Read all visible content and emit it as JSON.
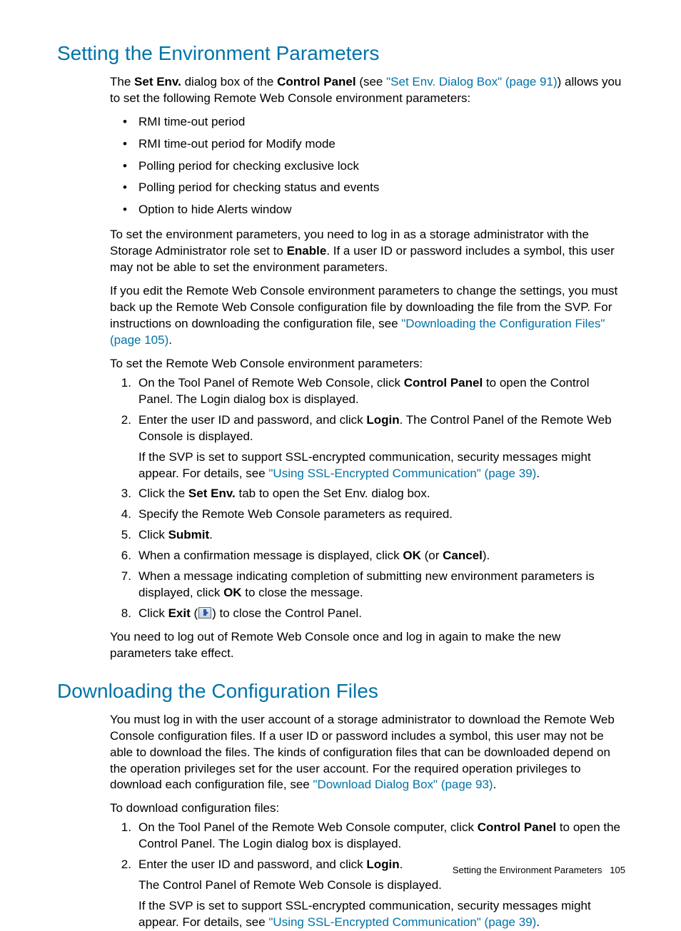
{
  "section1": {
    "heading": "Setting the Environment Parameters",
    "intro_pre": "The ",
    "intro_b1": "Set Env.",
    "intro_mid1": " dialog box of the ",
    "intro_b2": "Control Panel",
    "intro_mid2": " (see ",
    "intro_link": "\"Set Env. Dialog Box\" (page 91)",
    "intro_post": ") allows you to set the following Remote Web Console environment parameters:",
    "bullets": [
      "RMI time-out period",
      "RMI time-out period for Modify mode",
      "Polling period for checking exclusive lock",
      "Polling period for checking status and events",
      "Option to hide Alerts window"
    ],
    "para2_pre": "To set the environment parameters, you need to log in as a storage administrator with the Storage Administrator role set to ",
    "para2_b": "Enable",
    "para2_post": ". If a user ID or password includes a symbol, this user may not be able to set the environment parameters.",
    "para3_pre": "If you edit the Remote Web Console environment parameters to change the settings, you must back up the Remote Web Console configuration file by downloading the file from the SVP. For instructions on downloading the configuration file, see ",
    "para3_link": "\"Downloading the Configuration Files\" (page 105)",
    "para3_post": ".",
    "para4": "To set the Remote Web Console environment parameters:",
    "steps": {
      "s1_pre": "On the Tool Panel of Remote Web Console, click ",
      "s1_b": "Control Panel",
      "s1_post": " to open the Control Panel. The Login dialog box is displayed.",
      "s2_pre": "Enter the user ID and password, and click ",
      "s2_b": "Login",
      "s2_post": ". The Control Panel of the Remote Web Console is displayed.",
      "s2_sub_pre": "If the SVP is set to support SSL-encrypted communication, security messages might appear. For details, see ",
      "s2_sub_link": "\"Using SSL-Encrypted Communication\" (page 39)",
      "s2_sub_post": ".",
      "s3_pre": "Click the ",
      "s3_b": "Set Env.",
      "s3_post": " tab to open the Set Env. dialog box.",
      "s4": "Specify the Remote Web Console parameters as required.",
      "s5_pre": "Click ",
      "s5_b": "Submit",
      "s5_post": ".",
      "s6_pre": "When a confirmation message is displayed, click ",
      "s6_b1": "OK",
      "s6_mid": " (or ",
      "s6_b2": "Cancel",
      "s6_post": ").",
      "s7_pre": "When a message indicating completion of submitting new environment parameters is displayed, click ",
      "s7_b": "OK",
      "s7_post": " to close the message.",
      "s8_pre": "Click ",
      "s8_b": "Exit",
      "s8_mid": " (",
      "s8_post": ") to close the Control Panel."
    },
    "para5": "You need to log out of Remote Web Console once and log in again to make the new parameters take effect."
  },
  "section2": {
    "heading": "Downloading the Configuration Files",
    "para1_pre": "You must log in with the user account of a storage administrator to download the Remote Web Console configuration files. If a user ID or password includes a symbol, this user may not be able to download the files. The kinds of configuration files that can be downloaded depend on the operation privileges set for the user account. For the required operation privileges to download each configuration file, see ",
    "para1_link": "\"Download Dialog Box\" (page 93)",
    "para1_post": ".",
    "para2": "To download configuration files:",
    "steps": {
      "s1_pre": "On the Tool Panel of the Remote Web Console computer, click ",
      "s1_b": "Control Panel",
      "s1_post": " to open the Control Panel. The Login dialog box is displayed.",
      "s2_pre": "Enter the user ID and password, and click ",
      "s2_b": "Login",
      "s2_post": ".",
      "s2_sub1": "The Control Panel of Remote Web Console is displayed.",
      "s2_sub2_pre": "If the SVP is set to support SSL-encrypted communication, security messages might appear. For details, see ",
      "s2_sub2_link": "\"Using SSL-Encrypted Communication\" (page 39)",
      "s2_sub2_post": "."
    }
  },
  "footer": {
    "title": "Setting the Environment Parameters",
    "page": "105"
  }
}
